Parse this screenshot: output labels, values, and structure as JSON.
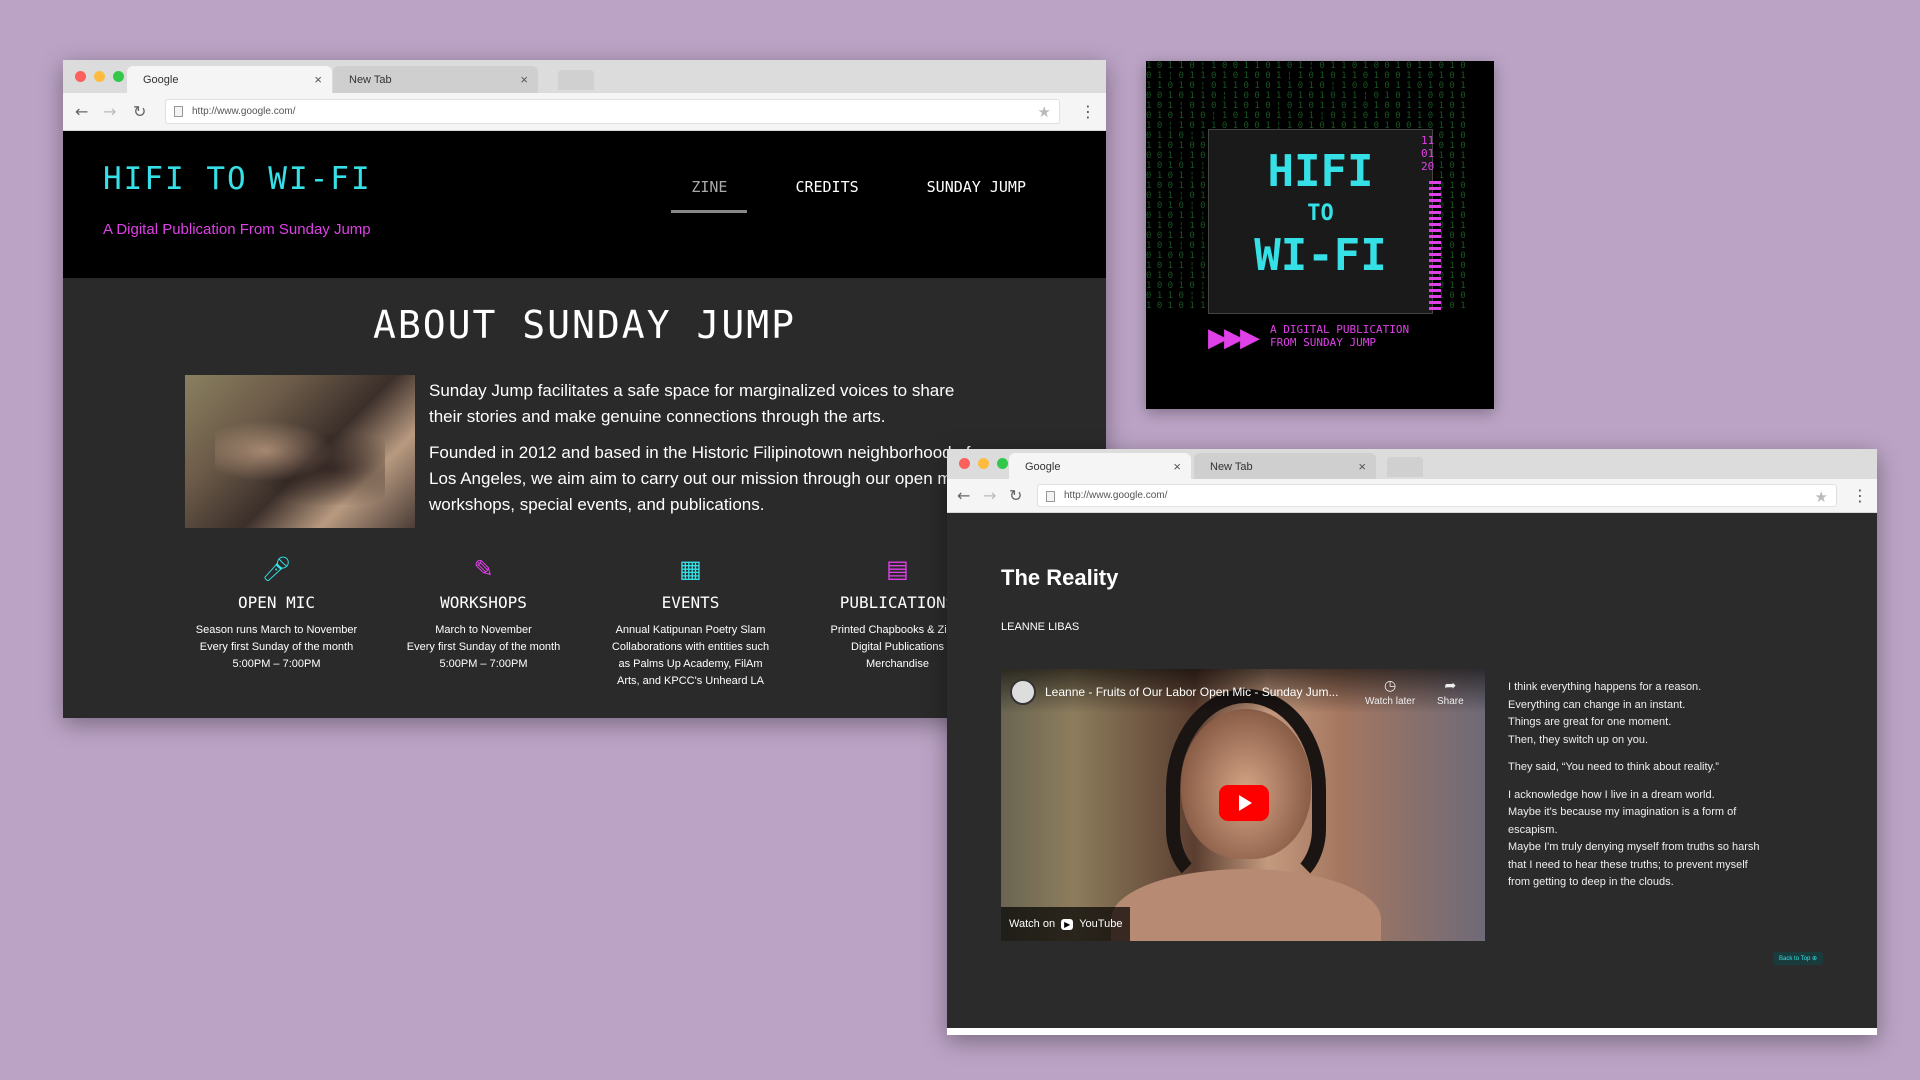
{
  "window1": {
    "tabs": [
      {
        "label": "Google",
        "active": true
      },
      {
        "label": "New Tab",
        "active": false
      }
    ],
    "url": "http://www.google.com/",
    "site": {
      "logo": "HIFI TO WI-FI",
      "tagline": "A Digital Publication From Sunday Jump",
      "nav": [
        {
          "label": "ZINE",
          "current": true
        },
        {
          "label": "CREDITS",
          "current": false
        },
        {
          "label": "SUNDAY JUMP",
          "current": false
        }
      ],
      "heading": "ABOUT SUNDAY JUMP",
      "paragraphs": [
        "Sunday Jump facilitates a safe space for marginalized voices to share their stories and make genuine connections through the arts.",
        "Founded in 2012 and based in the Historic Filipinotown neighborhood of Los Angeles, we aim aim to carry out our mission through our open mic, workshops, special events, and publications."
      ],
      "features": [
        {
          "icon": "microphone-icon",
          "title": "OPEN MIC",
          "lines": [
            "Season runs March to November",
            "Every first Sunday of the month",
            "5:00PM – 7:00PM"
          ]
        },
        {
          "icon": "pencil-icon",
          "title": "WORKSHOPS",
          "lines": [
            "March to November",
            "Every first Sunday of the month",
            "5:00PM – 7:00PM"
          ]
        },
        {
          "icon": "building-icon",
          "title": "EVENTS",
          "lines": [
            "Annual Katipunan Poetry Slam",
            "Collaborations with entities such",
            "as Palms Up Academy, FilAm",
            "Arts, and KPCC's Unheard LA"
          ]
        },
        {
          "icon": "book-icon",
          "title": "PUBLICATIONS",
          "lines": [
            "Printed Chapbooks & Zines",
            "Digital Publications",
            "Merchandise"
          ]
        }
      ]
    }
  },
  "poster": {
    "title_line1": "HIFI",
    "title_line2": "TO",
    "title_line3": "WI-FI",
    "date": [
      "11",
      "01",
      "20"
    ],
    "subtitle_line1": "A DIGITAL PUBLICATION",
    "subtitle_line2": "FROM SUNDAY JUMP"
  },
  "window2": {
    "tabs": [
      {
        "label": "Google",
        "active": true
      },
      {
        "label": "New Tab",
        "active": false
      }
    ],
    "url": "http://www.google.com/",
    "article": {
      "title": "The Reality",
      "author": "LEANNE LIBAS",
      "video": {
        "title": "Leanne - Fruits of Our Labor Open Mic - Sunday Jum...",
        "watch_later": "Watch later",
        "share": "Share",
        "watch_on": "Watch on",
        "youtube": "YouTube"
      },
      "poem": [
        [
          "I think everything happens for a reason.",
          "Everything can change in an instant.",
          "Things are great for one moment.",
          "Then, they switch up on you."
        ],
        [
          "They said, “You need to think about reality.”"
        ],
        [
          "I acknowledge how I live in a dream world.",
          "Maybe it's because my imagination is a form of",
          "escapism.",
          "Maybe I'm truly denying myself from truths so harsh",
          "that I need to hear these truths; to prevent myself",
          "from getting to deep in the clouds."
        ]
      ],
      "back_to_top": "Back to Top"
    }
  },
  "colors": {
    "background": "#bba3c5",
    "cyan": "#35e0e6",
    "magenta": "#e040e8"
  }
}
